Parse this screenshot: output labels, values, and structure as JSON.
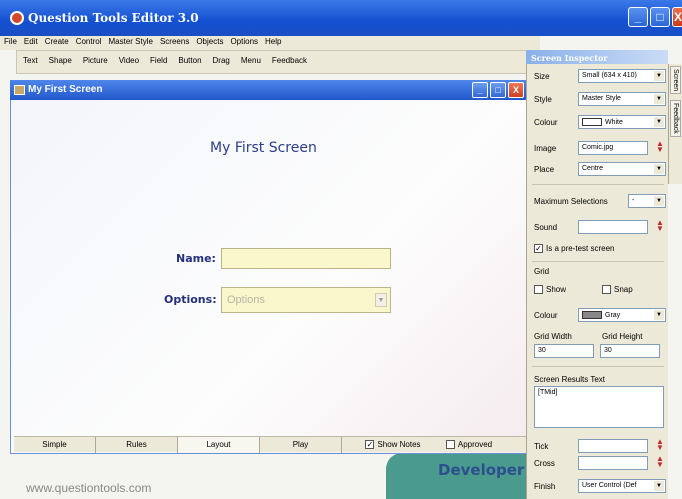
{
  "window": {
    "title": "Question Tools Editor 3.0",
    "controls": [
      "_",
      "□",
      "X"
    ]
  },
  "menu": [
    "File",
    "Edit",
    "Create",
    "Control",
    "Master Style",
    "Screens",
    "Objects",
    "Options",
    "Help"
  ],
  "toolbar": [
    "Text",
    "Shape",
    "Picture",
    "Video",
    "Field",
    "Button",
    "Drag",
    "Menu",
    "Feedback"
  ],
  "screen": {
    "window_title": "My First Screen",
    "heading": "My First Screen",
    "name_label": "Name:",
    "options_label": "Options:",
    "options_placeholder": "Options"
  },
  "bottom_tabs": {
    "simple": "Simple",
    "rules": "Rules",
    "layout": "Layout",
    "play": "Play",
    "show_notes": "Show Notes",
    "approved": "Approved",
    "show_notes_checked": true,
    "approved_checked": false
  },
  "background": {
    "developer": "Developer",
    "website": "www.questiontools.com"
  },
  "inspector": {
    "title": "Screen Inspector",
    "size_label": "Size",
    "size_value": "Small (634 x 410)",
    "style_label": "Style",
    "style_value": "Master Style",
    "colour_label": "Colour",
    "colour_value": "White",
    "image_label": "Image",
    "image_value": "Comic.jpg",
    "place_label": "Place",
    "place_value": "Centre",
    "maxsel_label": "Maximum Selections",
    "maxsel_value": "-",
    "sound_label": "Sound",
    "pretest_label": "Is a pre-test screen",
    "pretest_checked": true,
    "grid_label": "Grid",
    "show_label": "Show",
    "snap_label": "Snap",
    "grid_colour_label": "Colour",
    "grid_colour_value": "Gray",
    "grid_width_label": "Grid Width",
    "grid_width_value": "30",
    "grid_height_label": "Grid Height",
    "grid_height_value": "30",
    "results_label": "Screen Results Text",
    "results_value": "[TMid]",
    "tick_label": "Tick",
    "cross_label": "Cross",
    "finish_label": "Finish",
    "finish_value": "User Control (Def"
  },
  "side_tabs": [
    "Screen",
    "Feedback"
  ],
  "colors": {
    "titlebar": "#1450d0",
    "field_fill": "#fbf7cd",
    "label_text": "#23307a"
  }
}
